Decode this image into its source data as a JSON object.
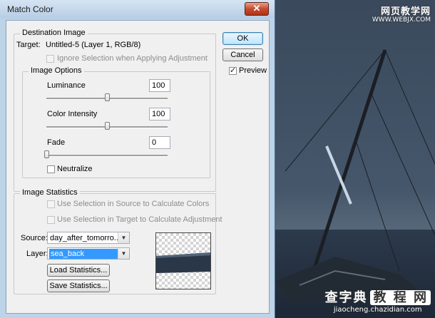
{
  "window": {
    "title": "Match Color",
    "close_glyph": "✕"
  },
  "buttons": {
    "ok": "OK",
    "cancel": "Cancel"
  },
  "preview": {
    "label": "Preview",
    "checked": true
  },
  "destination": {
    "legend": "Destination Image",
    "target_label": "Target:",
    "target_value": "Untitled-5 (Layer 1, RGB/8)",
    "ignore_selection_label": "Ignore Selection when Applying Adjustment"
  },
  "image_options": {
    "legend": "Image Options",
    "luminance": {
      "label": "Luminance",
      "value": "100",
      "slider_fraction": 0.5
    },
    "color_intensity": {
      "label": "Color Intensity",
      "value": "100",
      "slider_fraction": 0.5
    },
    "fade": {
      "label": "Fade",
      "value": "0",
      "slider_fraction": 0.0
    },
    "neutralize_label": "Neutralize"
  },
  "statistics": {
    "legend": "Image Statistics",
    "use_source_label": "Use Selection in Source to Calculate Colors",
    "use_target_label": "Use Selection in Target to Calculate Adjustment",
    "source_label": "Source:",
    "source_value": "day_after_tomorro...",
    "layer_label": "Layer:",
    "layer_value": "sea_back",
    "load_button": "Load Statistics...",
    "save_button": "Save Statistics..."
  },
  "watermarks": {
    "top_line1": "网页教学网",
    "top_line2": "WWW.WEBJX.COM",
    "bottom_line1": "查字典",
    "bottom_box": "教 程 网",
    "bottom_line2": "jiaocheng.chazidian.com"
  },
  "icons": {
    "close": "close-icon",
    "dropdown": "chevron-down-icon",
    "check": "checkmark-icon"
  },
  "colors": {
    "window_frame": "#bcd3e8",
    "dialog_bg": "#f0f0f0",
    "photo_sky": "#3e4d60",
    "selection_highlight": "#3399ff"
  }
}
